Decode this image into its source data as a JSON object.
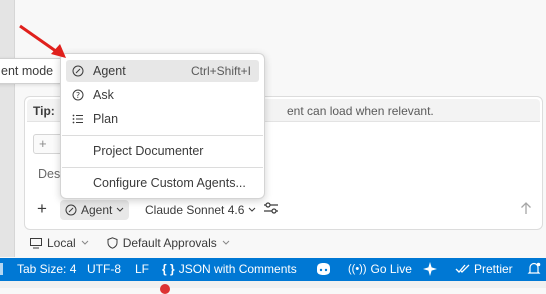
{
  "tooltip": {
    "text": "ent mode"
  },
  "tip": {
    "label": "Tip:",
    "text": "ent can load when relevant."
  },
  "input": {
    "placeholder_partial": "Des"
  },
  "toolbar": {
    "add_label": "+",
    "agent_label": "Agent",
    "model_label": "Claude Sonnet 4.6"
  },
  "bottom": {
    "local_label": "Local",
    "approvals_label": "Default Approvals"
  },
  "menu": {
    "items": [
      {
        "label": "Agent",
        "shortcut": "Ctrl+Shift+I",
        "icon": "agent-icon",
        "selected": true
      },
      {
        "label": "Ask",
        "icon": "ask-icon"
      },
      {
        "label": "Plan",
        "icon": "plan-icon"
      },
      {
        "label": "Project Documenter"
      },
      {
        "label": "Configure Custom Agents..."
      }
    ]
  },
  "status_bar": {
    "tab_size": "Tab Size: 4",
    "encoding": "UTF-8",
    "eol": "LF",
    "language": "JSON with Comments",
    "go_live": "Go Live",
    "prettier": "Prettier"
  },
  "colors": {
    "status_bar_bg": "#0078d4",
    "arrow": "#e0201c",
    "menu_highlight": "#e7e7e7"
  }
}
